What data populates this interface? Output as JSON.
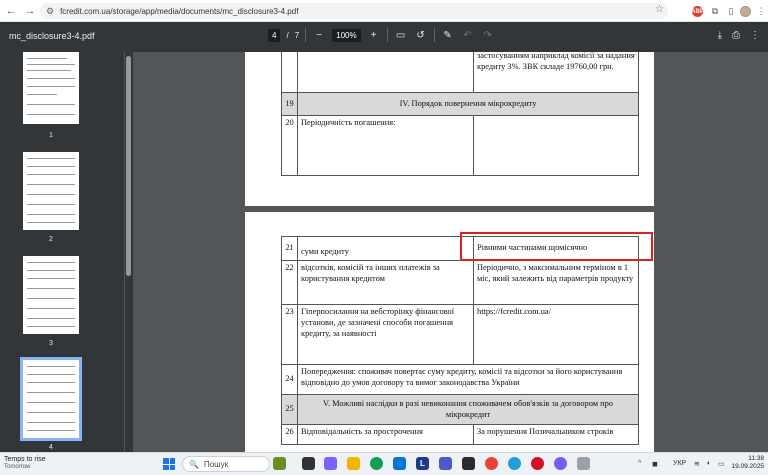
{
  "browser": {
    "url": "fcredit.com.ua/storage/app/media/documents/mc_disclosure3-4.pdf",
    "nav": {
      "back": "←",
      "forward": "→",
      "reload": "⟳"
    },
    "icons": [
      "tune-icon",
      "star-icon",
      "adblock-icon",
      "extensions-icon",
      "sidebar-icon",
      "avatar-icon",
      "menu-icon"
    ],
    "adblock_label": "ABP"
  },
  "pdf_toolbar": {
    "filename": "mc_disclosure3-4.pdf",
    "page_current": "4",
    "page_sep": "/",
    "page_total": "7",
    "zoom_out": "−",
    "zoom": "100%",
    "zoom_in": "+"
  },
  "thumbnails": [
    {
      "label": "1"
    },
    {
      "label": "2"
    },
    {
      "label": "3"
    },
    {
      "label": "4"
    }
  ],
  "page_top": {
    "row_cont_text": "застосуванням наприклад комісії за надання кредиту 3%. ЗВК складе 19760,00 грн.",
    "row19_num": "19",
    "row19_title": "IV. Порядок повернення мікрокредиту",
    "row20_num": "20",
    "row20_label": "Періодичність погашення:"
  },
  "page_bottom": {
    "rows": [
      {
        "num": "21",
        "label": "суми кредиту",
        "value": "Рівними частинами щомісячно"
      },
      {
        "num": "22",
        "label": "відсотків, комісій та інших платежів за користування кредитом",
        "value": "Періодично, з максимальним терміном в 1 міс, який залежить від параметрів продукту"
      },
      {
        "num": "23",
        "label": "Гіперпосилання на вебсторінку фінансової установи, де зазначені способи погашення кредиту, за наявності",
        "value": "https://fcredit.com.ua/"
      }
    ],
    "row24_num": "24",
    "row24_text": "Попередження: споживач повертає суму кредиту, комісії та відсотки за його користування відповідно до умов договору та вимог законодавства України",
    "row25_num": "25",
    "row25_text": "V. Можливі наслідки в разі невиконання споживачем обов'язків за договором про мікрокредит",
    "row26_num": "26",
    "row26_label": "Відповідальність за прострочення",
    "row26_value": "За порушення Позичальником строків"
  },
  "taskbar": {
    "weather_title": "Temps to rise",
    "weather_sub": "Tomorrow",
    "search_placeholder": "Пошук",
    "lang": "УКР",
    "time": "11:38",
    "date": "19.09.2025"
  },
  "colors": {
    "highlight_box": "#e0201f",
    "toolbar_bg": "#323639",
    "viewer_bg": "#525659"
  }
}
